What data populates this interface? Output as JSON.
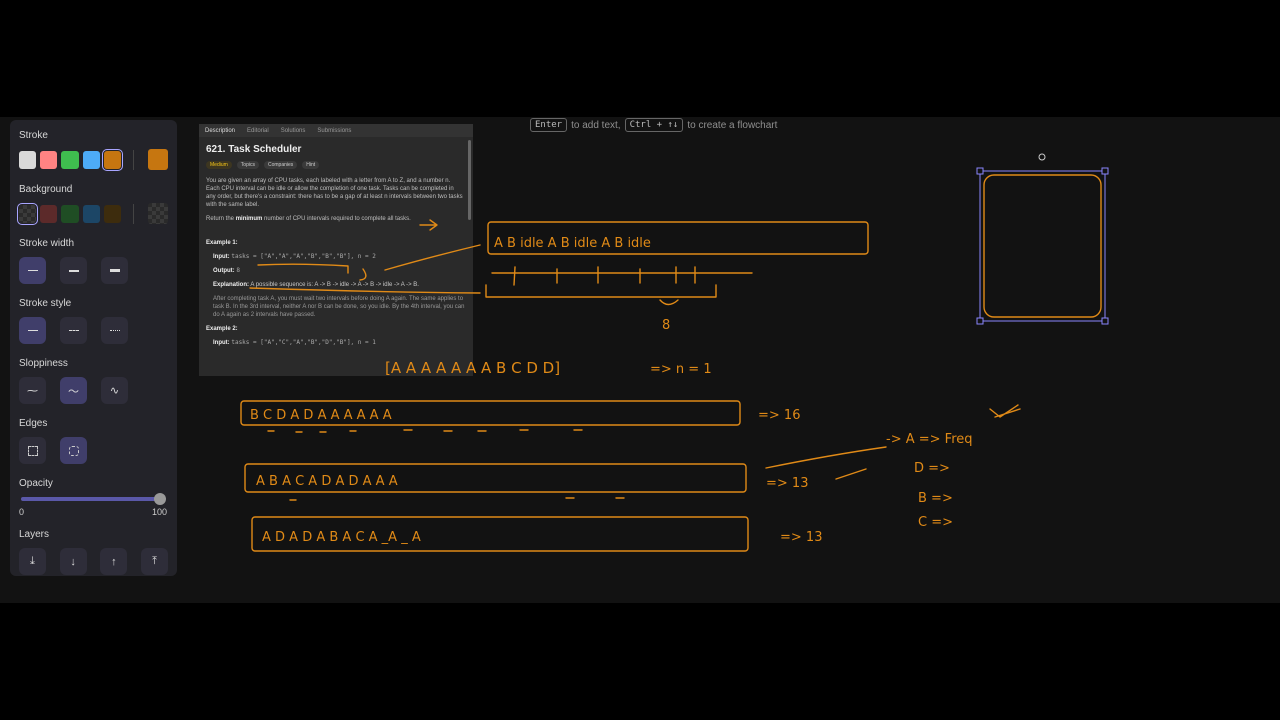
{
  "hint": {
    "key1": "Enter",
    "text1": "to add text,",
    "key2": "Ctrl + ↑↓",
    "text2": "to create a flowchart"
  },
  "props": {
    "stroke_title": "Stroke",
    "stroke_colors": [
      "#d9d9d9",
      "#ff8383",
      "#3fbd4f",
      "#4dabf7",
      "#c67610"
    ],
    "stroke_current": "#c67610",
    "background_title": "Background",
    "background_colors": [
      "transparent",
      "#5c2a2a",
      "#1f4d24",
      "#1c4666",
      "#3d2c0d"
    ],
    "stroke_width_title": "Stroke width",
    "stroke_style_title": "Stroke style",
    "sloppiness_title": "Sloppiness",
    "edges_title": "Edges",
    "opacity_title": "Opacity",
    "opacity_min": "0",
    "opacity_max": "100",
    "opacity_value": 100,
    "layers_title": "Layers"
  },
  "leetcode": {
    "tabs": [
      "Description",
      "Editorial",
      "Solutions",
      "Submissions"
    ],
    "title": "621. Task Scheduler",
    "tags": [
      "Medium",
      "Topics",
      "Companies",
      "Hint"
    ],
    "p1": "You are given an array of CPU tasks, each labeled with a letter from A to Z, and a number n. Each CPU interval can be idle or allow the completion of one task. Tasks can be completed in any order, but there's a constraint: there has to be a gap of at least n intervals between two tasks with the same label.",
    "p2a": "Return the",
    "p2b": "minimum",
    "p2c": "number of CPU intervals required to complete all tasks.",
    "ex1_title": "Example 1:",
    "ex1_input_label": "Input:",
    "ex1_input": "tasks = [\"A\",\"A\",\"A\",\"B\",\"B\",\"B\"], n = 2",
    "ex1_output_label": "Output:",
    "ex1_output": "8",
    "ex1_expl_label": "Explanation:",
    "ex1_expl": "A possible sequence is: A -> B -> idle -> A -> B -> idle -> A -> B.",
    "ex1_detail": "After completing task A, you must wait two intervals before doing A again. The same applies to task B. In the 3rd interval, neither A nor B can be done, so you idle. By the 4th interval, you can do A again as 2 intervals have passed.",
    "ex2_title": "Example 2:",
    "ex2_input_label": "Input:",
    "ex2_input": "tasks = [\"A\",\"C\",\"A\",\"B\",\"D\",\"B\"], n = 1"
  },
  "ink": {
    "row1": "A B  idle A B   idle  A  B   idle",
    "mark8": "8",
    "bracket": "[A A A A A A A  B C D D]",
    "n_eq": "=> n = 1",
    "box1": "B C D A D  A   A   A   A   A   A",
    "r1": "=> 16",
    "box2": "A B A  C  A D A  D A   A   A",
    "r2": "=> 13",
    "box3": "A D A D  A  B  A  C A  _A _ A",
    "r3": "=> 13",
    "freq": "-> A => Freq",
    "d_arrow": "D =>",
    "b_arrow": "B =>",
    "c_arrow": "C =>"
  }
}
